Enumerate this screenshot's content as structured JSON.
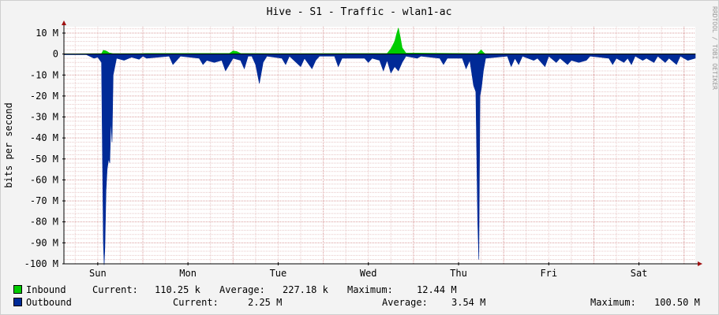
{
  "chart_data": {
    "type": "area",
    "title": "Hive - S1 - Traffic - wlan1-ac",
    "ylabel": "bits per second",
    "watermark": "RRDTOOL / TOBI OETIKER",
    "ylim": [
      -100000000,
      13000000
    ],
    "y_ticks": [
      {
        "value": 10000000,
        "label": "10 M"
      },
      {
        "value": 0,
        "label": "0"
      },
      {
        "value": -10000000,
        "label": "-10 M"
      },
      {
        "value": -20000000,
        "label": "-20 M"
      },
      {
        "value": -30000000,
        "label": "-30 M"
      },
      {
        "value": -40000000,
        "label": "-40 M"
      },
      {
        "value": -50000000,
        "label": "-50 M"
      },
      {
        "value": -60000000,
        "label": "-60 M"
      },
      {
        "value": -70000000,
        "label": "-70 M"
      },
      {
        "value": -80000000,
        "label": "-80 M"
      },
      {
        "value": -90000000,
        "label": "-90 M"
      },
      {
        "value": -100000000,
        "label": "-100 M"
      }
    ],
    "x_range_hours": [
      0,
      168
    ],
    "x_ticks": [
      {
        "label": "Sun",
        "hour": 9
      },
      {
        "label": "Mon",
        "hour": 33
      },
      {
        "label": "Tue",
        "hour": 57
      },
      {
        "label": "Wed",
        "hour": 81
      },
      {
        "label": "Thu",
        "hour": 105
      },
      {
        "label": "Fri",
        "hour": 129
      },
      {
        "label": "Sat",
        "hour": 153
      }
    ],
    "series": [
      {
        "name": "Inbound",
        "color": "#00cc00",
        "points": [
          [
            0,
            0.1
          ],
          [
            10,
            0.2
          ],
          [
            10.5,
            1.8
          ],
          [
            11,
            1.6
          ],
          [
            11.5,
            1.2
          ],
          [
            12,
            0.6
          ],
          [
            13,
            0.2
          ],
          [
            20,
            0.2
          ],
          [
            22,
            0.3
          ],
          [
            44,
            0.3
          ],
          [
            45,
            1.5
          ],
          [
            46,
            1.2
          ],
          [
            47,
            0.3
          ],
          [
            55,
            0.2
          ],
          [
            86,
            0.3
          ],
          [
            87,
            2.5
          ],
          [
            88,
            6.0
          ],
          [
            88.5,
            9.5
          ],
          [
            89,
            12.44
          ],
          [
            89.5,
            8.0
          ],
          [
            90,
            3.0
          ],
          [
            91,
            0.5
          ],
          [
            110,
            0.2
          ],
          [
            110.6,
            1.2
          ],
          [
            111,
            2.0
          ],
          [
            111.5,
            1.0
          ],
          [
            112,
            0.2
          ],
          [
            168,
            0.1
          ]
        ]
      },
      {
        "name": "Outbound",
        "color": "#002a97",
        "points": [
          [
            0,
            0.3
          ],
          [
            6,
            0.3
          ],
          [
            8,
            2.0
          ],
          [
            9,
            1.5
          ],
          [
            10,
            4.0
          ],
          [
            10.3,
            56.0
          ],
          [
            10.5,
            90.0
          ],
          [
            10.7,
            100.5
          ],
          [
            10.9,
            92.0
          ],
          [
            11.2,
            65.0
          ],
          [
            11.5,
            55.0
          ],
          [
            11.9,
            50.0
          ],
          [
            12.2,
            52.0
          ],
          [
            12.5,
            31.0
          ],
          [
            12.8,
            42.0
          ],
          [
            13.1,
            10.0
          ],
          [
            14,
            2.0
          ],
          [
            16,
            3.0
          ],
          [
            18,
            1.5
          ],
          [
            20,
            2.5
          ],
          [
            21,
            1.0
          ],
          [
            22,
            2.0
          ],
          [
            28,
            1.0
          ],
          [
            29,
            5.0
          ],
          [
            30,
            3.0
          ],
          [
            31,
            1.0
          ],
          [
            36,
            2.0
          ],
          [
            37,
            5.0
          ],
          [
            38,
            3.0
          ],
          [
            40,
            4.0
          ],
          [
            42,
            3.0
          ],
          [
            43,
            8.0
          ],
          [
            44,
            5.0
          ],
          [
            45,
            2.0
          ],
          [
            47,
            3.0
          ],
          [
            48,
            7.0
          ],
          [
            49,
            1.0
          ],
          [
            50,
            1.0
          ],
          [
            51,
            5.0
          ],
          [
            52,
            14.0
          ],
          [
            53,
            4.0
          ],
          [
            54,
            1.0
          ],
          [
            58,
            2.0
          ],
          [
            59,
            5.0
          ],
          [
            60,
            1.0
          ],
          [
            63,
            6.0
          ],
          [
            64,
            2.0
          ],
          [
            66,
            7.0
          ],
          [
            67,
            3.0
          ],
          [
            68,
            1.0
          ],
          [
            72,
            1.0
          ],
          [
            73,
            6.0
          ],
          [
            74,
            2.0
          ],
          [
            80,
            2.0
          ],
          [
            81,
            4.0
          ],
          [
            82,
            2.0
          ],
          [
            84,
            3.0
          ],
          [
            85,
            8.0
          ],
          [
            86,
            3.0
          ],
          [
            87,
            9.0
          ],
          [
            88,
            6.0
          ],
          [
            89,
            8.0
          ],
          [
            90,
            4.0
          ],
          [
            91,
            1.0
          ],
          [
            94,
            2.0
          ],
          [
            95,
            1.0
          ],
          [
            100,
            2.0
          ],
          [
            101,
            5.0
          ],
          [
            102,
            2.0
          ],
          [
            106,
            2.0
          ],
          [
            107,
            7.0
          ],
          [
            108,
            3.0
          ],
          [
            109,
            15.0
          ],
          [
            109.6,
            18.0
          ],
          [
            110.1,
            80.0
          ],
          [
            110.4,
            98.0
          ],
          [
            110.7,
            20.0
          ],
          [
            111.1,
            16.0
          ],
          [
            111.6,
            8.0
          ],
          [
            112.2,
            2.0
          ],
          [
            118,
            1.0
          ],
          [
            119,
            6.0
          ],
          [
            120,
            2.0
          ],
          [
            121,
            5.0
          ],
          [
            122,
            1.0
          ],
          [
            125,
            3.0
          ],
          [
            126,
            2.0
          ],
          [
            128,
            6.0
          ],
          [
            129,
            1.0
          ],
          [
            131,
            4.0
          ],
          [
            132,
            2.0
          ],
          [
            134,
            5.0
          ],
          [
            135,
            3.0
          ],
          [
            137,
            4.0
          ],
          [
            139,
            3.0
          ],
          [
            140,
            1.0
          ],
          [
            145,
            2.0
          ],
          [
            146,
            5.0
          ],
          [
            147,
            2.0
          ],
          [
            149,
            4.0
          ],
          [
            150,
            2.0
          ],
          [
            151,
            5.0
          ],
          [
            152,
            1.0
          ],
          [
            154,
            3.0
          ],
          [
            155,
            2.0
          ],
          [
            157,
            4.0
          ],
          [
            158,
            1.0
          ],
          [
            160,
            4.0
          ],
          [
            161,
            2.0
          ],
          [
            163,
            5.0
          ],
          [
            164,
            1.0
          ],
          [
            166,
            3.0
          ],
          [
            168,
            2.0
          ]
        ]
      }
    ],
    "grid": true
  },
  "legend": {
    "inbound": {
      "label": "Inbound",
      "current_label": "Current:",
      "current": "110.25 k",
      "average_label": "Average:",
      "average": "227.18 k",
      "maximum_label": "Maximum:",
      "maximum": "12.44 M"
    },
    "outbound": {
      "label": "Outbound",
      "current_label": "Current:",
      "current": "2.25 M",
      "average_label": "Average:",
      "average": "3.54 M",
      "maximum_label": "Maximum:",
      "maximum": "100.50 M"
    }
  }
}
